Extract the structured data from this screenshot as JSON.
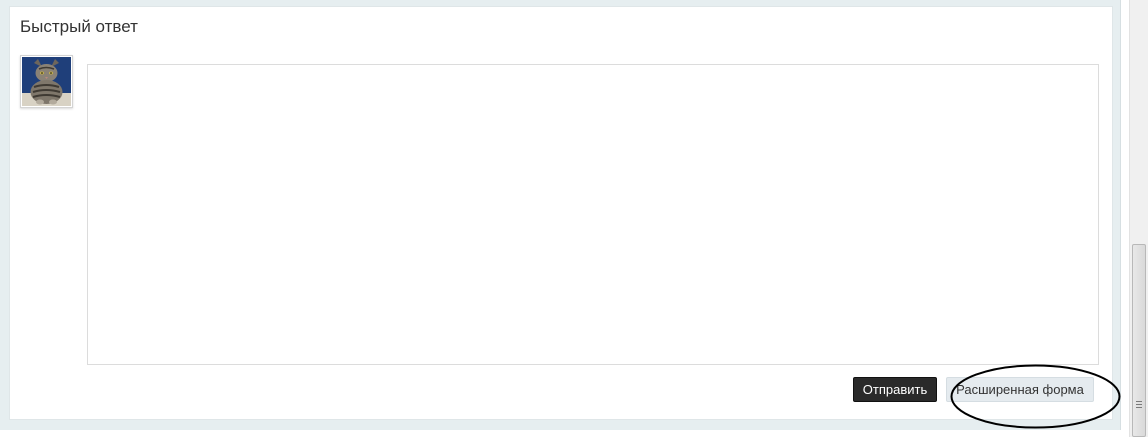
{
  "quick_reply": {
    "title": "Быстрый ответ",
    "textarea_value": "",
    "send_label": "Отправить",
    "advanced_label": "Расширенная форма"
  },
  "avatar": {
    "icon": "cat-avatar-icon"
  },
  "colors": {
    "page_bg": "#e6eef0",
    "panel_bg": "#ffffff",
    "send_button_bg": "#2a2a2a",
    "advanced_button_bg": "#e5ebef",
    "highlight_stroke": "#000000"
  }
}
